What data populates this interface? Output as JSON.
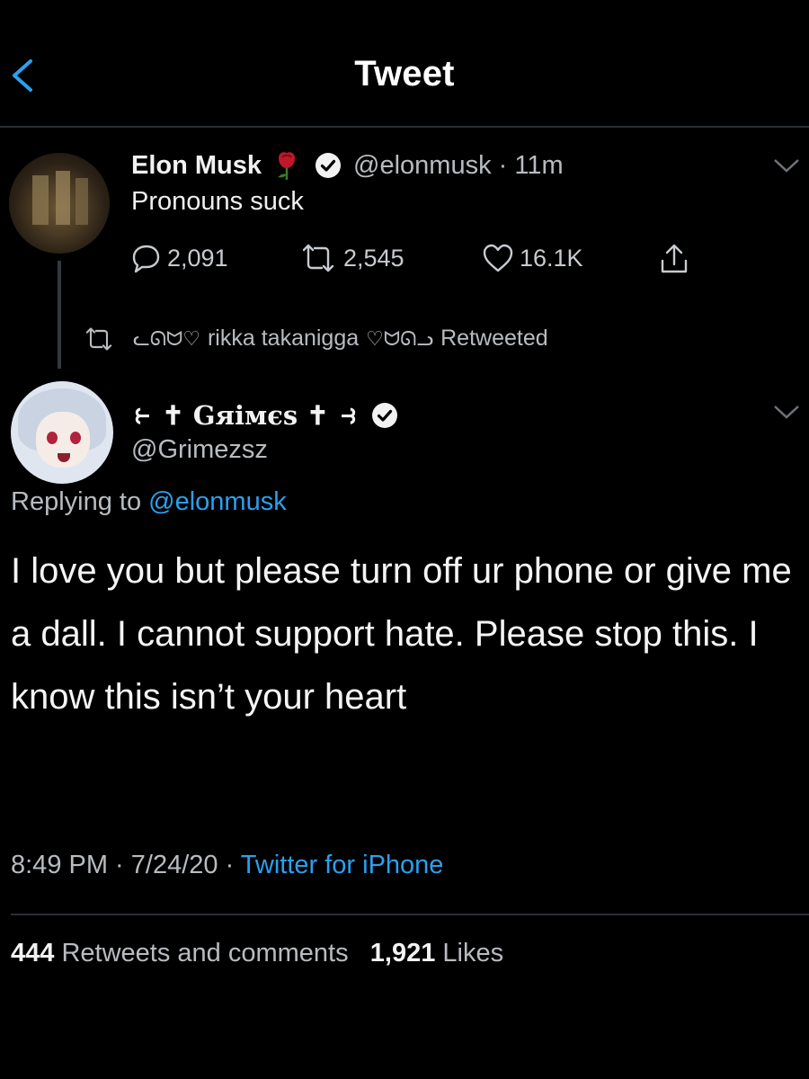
{
  "header": {
    "title": "Tweet"
  },
  "parent_tweet": {
    "name": "Elon Musk",
    "handle_time": "@elonmusk · 11m",
    "text": "Pronouns suck",
    "replies": "2,091",
    "retweets": "2,545",
    "likes": "16.1K"
  },
  "retweet_notice": {
    "prefix_deco": "ᓚᘏᗢ♡",
    "user": "rikka takanigga",
    "suffix_deco": "♡ᗢᘏᓗ",
    "label": "Retweeted"
  },
  "main_tweet": {
    "name": "⥼ ✝ Gяімєѕ ✝ ⥽",
    "handle": "@Grimezsz",
    "replying_prefix": "Replying to",
    "replying_mention": "@elonmusk",
    "text": "I love you but please turn off ur phone or give me a dall.  I cannot support hate. Please stop this. I know this isn’t your heart",
    "timestamp": "8:49 PM · 7/24/20 · ",
    "source": "Twitter for iPhone",
    "retweets_count": "444",
    "retweets_label": "Retweets and comments",
    "likes_count": "1,921",
    "likes_label": "Likes"
  },
  "colors": {
    "background": "#000000",
    "link": "#2aa0ef",
    "muted": "#b8bcc0",
    "divider": "#2a2f33"
  },
  "icons": [
    "back-arrow-icon",
    "rose-icon",
    "verified-icon",
    "reply-icon",
    "retweet-icon",
    "like-icon",
    "share-icon",
    "chevron-down-icon"
  ]
}
